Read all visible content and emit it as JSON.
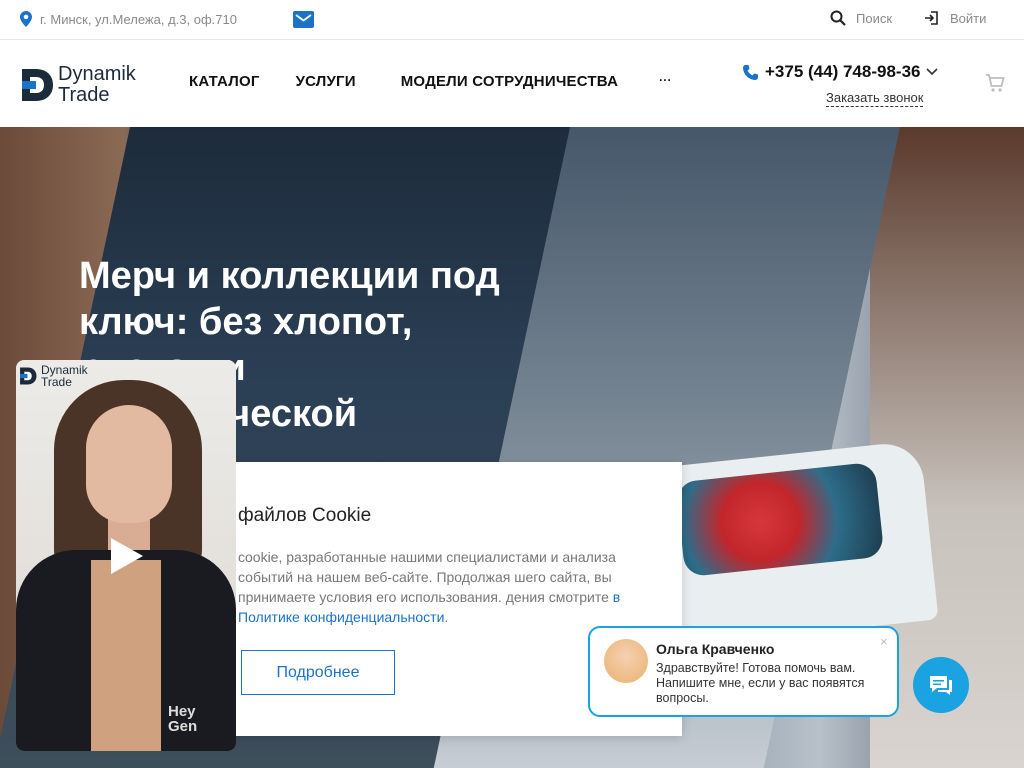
{
  "topbar": {
    "address": "г. Минск, ул.Мележа, д.3, оф.710",
    "search_label": "Поиск",
    "login_label": "Войти"
  },
  "header": {
    "logo_line1": "Dynamik",
    "logo_line2": "Trade",
    "nav": [
      "КАТАЛОГ",
      "УСЛУГИ",
      "МОДЕЛИ СОТРУДНИЧЕСТВА",
      "···"
    ],
    "phone": "+375 (44) 748-98-36",
    "callback_label": "Заказать звонок"
  },
  "hero": {
    "title": "Мерч и коллекции под ключ: без хлопот, рисков и логистической"
  },
  "cookie": {
    "title": "файлов Cookie",
    "text": "cookie, разработанные нашими специалистами и анализа событий на нашем веб-сайте. Продолжая шего сайта, вы принимаете условия его использования. дения смотрите ",
    "link_text": "в Политике конфиденциальности",
    "text_end": ".",
    "button_label": "Подробнее"
  },
  "video": {
    "logo_line1": "Dynamik",
    "logo_line2": "Trade",
    "watermark_line1": "Hey",
    "watermark_line2": "Gen"
  },
  "chat": {
    "agent_name": "Ольга Кравченко",
    "message": "Здравствуйте! Готова помочь вам. Напишите мне, если у вас появятся вопросы.",
    "close_symbol": "×"
  },
  "colors": {
    "accent": "#1a73c9",
    "chat_accent": "#1aa3e0",
    "text_dark": "#111111"
  }
}
